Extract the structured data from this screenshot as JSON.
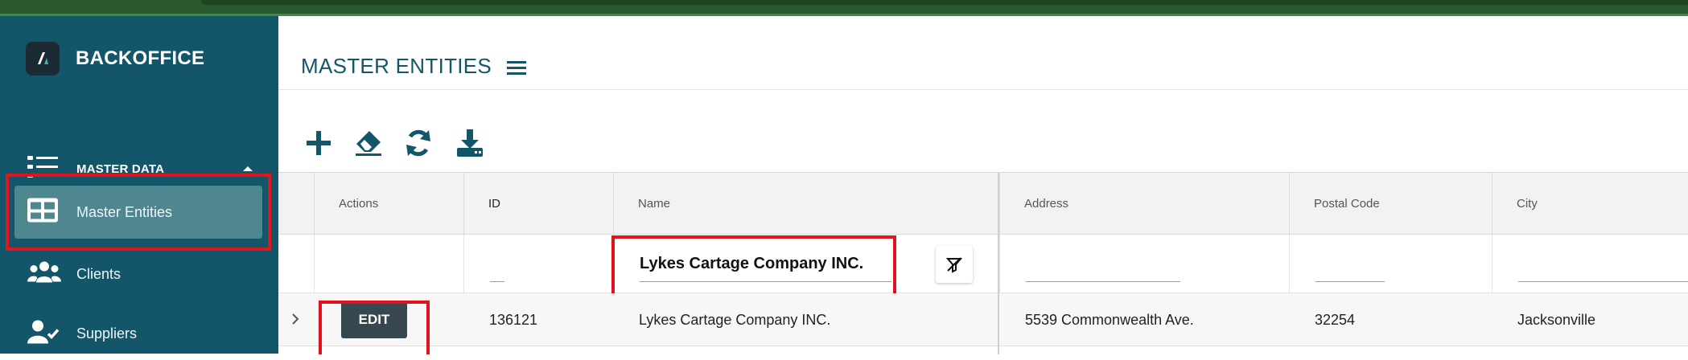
{
  "app": {
    "brand": "BACKOFFICE"
  },
  "sidebar": {
    "group": {
      "label": "MASTER DATA",
      "icon": "list-icon",
      "caret": "caret-up-icon"
    },
    "items": [
      {
        "label": "Master Entities",
        "icon": "table-icon",
        "active": true
      },
      {
        "label": "Clients",
        "icon": "users-icon",
        "active": false
      },
      {
        "label": "Suppliers",
        "icon": "user-check-icon",
        "active": false
      }
    ]
  },
  "page": {
    "title": "MASTER ENTITIES"
  },
  "toolbar": {
    "buttons": [
      "plus-icon",
      "eraser-icon",
      "refresh-icon",
      "download-icon"
    ]
  },
  "grid": {
    "columns": [
      "Actions",
      "ID",
      "Name",
      "Address",
      "Postal Code",
      "City"
    ],
    "filters": {
      "name": "Lykes Cartage Company INC."
    },
    "rows": [
      {
        "action": "EDIT",
        "id": "136121",
        "name": "Lykes Cartage Company INC.",
        "address": "5539 Commonwealth Ave.",
        "postal_code": "32254",
        "city": "Jacksonville"
      }
    ]
  },
  "colors": {
    "sidebar": "#13566a",
    "accent": "#13566a",
    "highlight": "#e0131f",
    "topbar": "#28582c"
  }
}
